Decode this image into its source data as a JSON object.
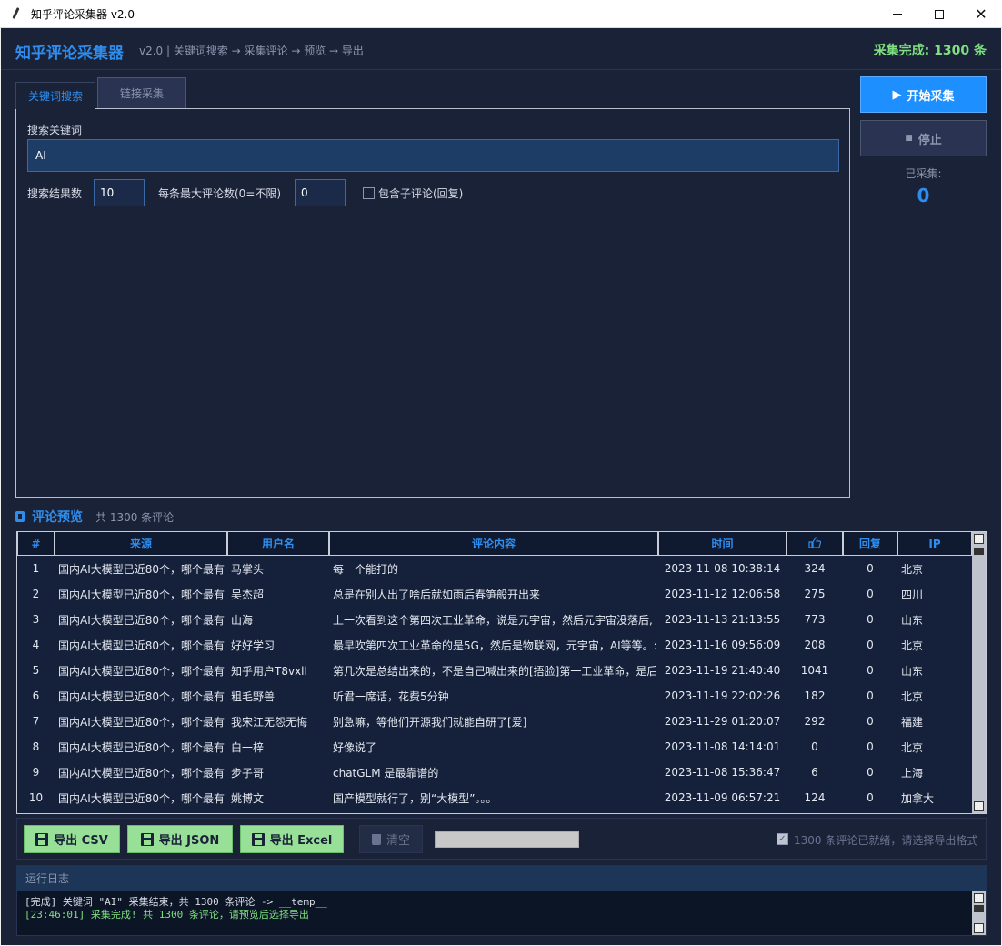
{
  "window": {
    "title": "知乎评论采集器 v2.0"
  },
  "header": {
    "brand": "知乎评论采集器",
    "subtitle": "v2.0  |  关键词搜索 → 采集评论 → 预览 → 导出",
    "status": "采集完成: 1300 条"
  },
  "tabs": [
    {
      "label": "关键词搜索",
      "active": true
    },
    {
      "label": "链接采集",
      "active": false
    }
  ],
  "search": {
    "keyword_label": "搜索关键词",
    "keyword_value": "AI",
    "results_label": "搜索结果数",
    "results_value": "10",
    "max_comments_label": "每条最大评论数(0=不限)",
    "max_comments_value": "0",
    "include_replies_label": "包含子评论(回复)",
    "include_replies_checked": false
  },
  "controls": {
    "start_label": "开始采集",
    "stop_label": "停止",
    "collected_label": "已采集:",
    "collected_value": "0"
  },
  "preview": {
    "title": "评论预览",
    "count_text": "共 1300 条评论",
    "columns": [
      "#",
      "来源",
      "用户名",
      "评论内容",
      "时间",
      "like-icon",
      "回复",
      "IP"
    ],
    "rows": [
      [
        "1",
        "国内AI大模型已近80个，哪个最有",
        "马掌头",
        "每一个能打的",
        "2023-11-08 10:38:14",
        "324",
        "0",
        "北京"
      ],
      [
        "2",
        "国内AI大模型已近80个，哪个最有",
        "吴杰超",
        "总是在别人出了啥后就如雨后春笋般开出来",
        "2023-11-12 12:06:58",
        "275",
        "0",
        "四川"
      ],
      [
        "3",
        "国内AI大模型已近80个，哪个最有",
        "山海",
        "上一次看到这个第四次工业革命，说是元宇宙，然后元宇宙没落后,",
        "2023-11-13 21:13:55",
        "773",
        "0",
        "山东"
      ],
      [
        "4",
        "国内AI大模型已近80个，哪个最有",
        "好好学习",
        "最早吹第四次工业革命的是5G，然后是物联网，元宇宙，AI等等。:",
        "2023-11-16 09:56:09",
        "208",
        "0",
        "北京"
      ],
      [
        "5",
        "国内AI大模型已近80个，哪个最有",
        "知乎用户T8vxll",
        "第几次是总结出来的，不是自己喊出来的[捂脸]第一工业革命，是后",
        "2023-11-19 21:40:40",
        "1041",
        "0",
        "山东"
      ],
      [
        "6",
        "国内AI大模型已近80个，哪个最有",
        "粗毛野兽",
        "听君一席话，花费5分钟",
        "2023-11-19 22:02:26",
        "182",
        "0",
        "北京"
      ],
      [
        "7",
        "国内AI大模型已近80个，哪个最有",
        "我宋江无怨无悔",
        "别急嘛，等他们开源我们就能自研了[爱]",
        "2023-11-29 01:20:07",
        "292",
        "0",
        "福建"
      ],
      [
        "8",
        "国内AI大模型已近80个，哪个最有",
        "白一梓",
        "好像说了",
        "2023-11-08 14:14:01",
        "0",
        "0",
        "北京"
      ],
      [
        "9",
        "国内AI大模型已近80个，哪个最有",
        "步子哥",
        "chatGLM 是最靠谱的",
        "2023-11-08 15:36:47",
        "6",
        "0",
        "上海"
      ],
      [
        "10",
        "国内AI大模型已近80个，哪个最有",
        "姚博文",
        "国产模型就行了，别“大模型”。。。",
        "2023-11-09 06:57:21",
        "124",
        "0",
        "加拿大"
      ]
    ]
  },
  "export": {
    "csv_label": "导出 CSV",
    "json_label": "导出 JSON",
    "excel_label": "导出 Excel",
    "clear_label": "清空",
    "progress_fraction": 0,
    "ready_text": "1300 条评论已就绪，请选择导出格式"
  },
  "log": {
    "title": "运行日志",
    "lines": [
      "[完成] 关键词 \"AI\" 采集结束，共 1300 条评论 -> __temp__",
      "[23:46:01] 采集完成! 共 1300 条评论，请预览后选择导出"
    ]
  },
  "colors": {
    "accent": "#2e8ef0",
    "success": "#7ee07e",
    "background": "#1a2238",
    "export_button": "#98e098"
  }
}
